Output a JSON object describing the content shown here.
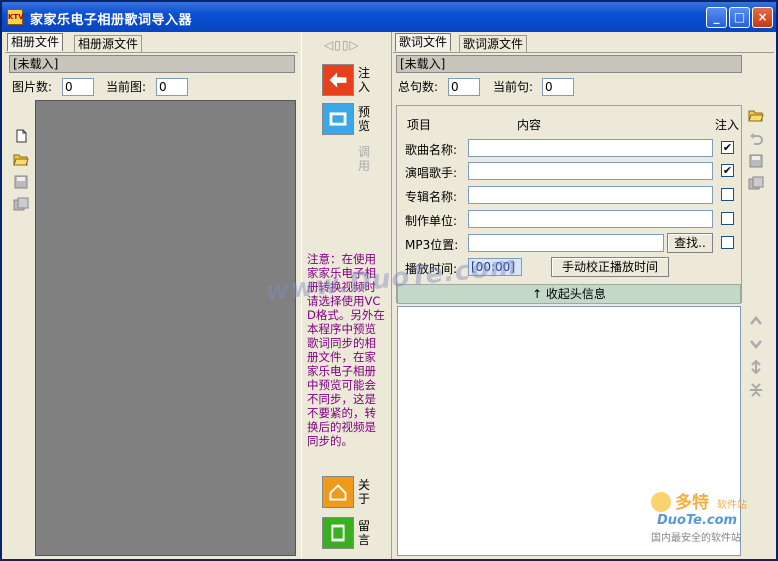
{
  "window": {
    "title": "家家乐电子相册歌词导入器",
    "icon_label": "KTV",
    "minimize": "_",
    "maximize": "□",
    "close": "×"
  },
  "left": {
    "tabs": [
      "相册文件",
      "相册源文件"
    ],
    "status": "[未载入]",
    "photo_count_label": "图片数:",
    "photo_count": "0",
    "current_label": "当前图:",
    "current": "0",
    "tools": [
      "new-icon",
      "open-folder-icon",
      "save-icon",
      "save-as-icon"
    ]
  },
  "middle": {
    "nav": "◁▯▯▷",
    "inject_label": "注入",
    "preview_label": "预览",
    "call_label": "调用",
    "note": "注意：在使用家家乐电子相册转换视频时请选择使用VCD格式。另外在本程序中预览歌词同步的相册文件，在家家乐电子相册中预览可能会不同步，这是不要紧的，转换后的视频是同步的。",
    "about_label": "关于",
    "message_label": "留言"
  },
  "right": {
    "tabs": [
      "歌词文件",
      "歌词源文件"
    ],
    "status": "[未载入]",
    "total_label": "总句数:",
    "total": "0",
    "current_label": "当前句:",
    "current": "0",
    "headers": {
      "item": "项目",
      "content": "内容",
      "inject": "注入"
    },
    "fields": [
      {
        "label": "歌曲名称:",
        "value": "",
        "checked": true
      },
      {
        "label": "演唱歌手:",
        "value": "",
        "checked": true
      },
      {
        "label": "专辑名称:",
        "value": "",
        "checked": false
      },
      {
        "label": "制作单位:",
        "value": "",
        "checked": false
      },
      {
        "label": "MP3位置:",
        "value": "",
        "checked": false
      }
    ],
    "browse_button": "查找..",
    "play_time_label": "播放时间:",
    "play_time": "[00:00]",
    "calibrate_button": "手动校正播放时间",
    "collapse_button": "↑  收起头信息",
    "tools_top": [
      "open-folder-icon",
      "undo-icon",
      "save-icon",
      "save-as-icon"
    ],
    "tools_side": [
      "move-up-icon",
      "move-down-icon",
      "expand-icon",
      "collapse-icon"
    ]
  },
  "watermark": {
    "text": "www.DuoTe.com",
    "logo_text": "多特",
    "logo_sub": "软件站",
    "logo_domain": "DuoTe.com",
    "logo_slogan": "国内最安全的软件站"
  },
  "colors": {
    "titlebar": "#0a4fd4",
    "note": "#800080",
    "collapse_bar": "#c4d8c8",
    "inject": "#e8401c",
    "preview": "#3aa8e8",
    "about": "#f09a1c",
    "message": "#38b020"
  }
}
